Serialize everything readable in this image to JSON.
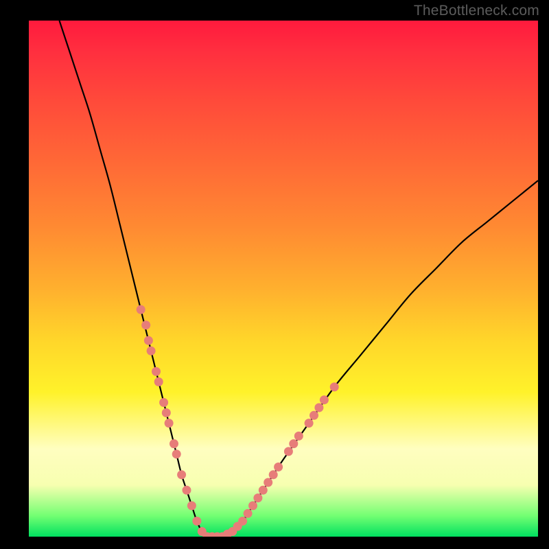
{
  "watermark": "TheBottleneck.com",
  "colors": {
    "frame": "#000000",
    "curve": "#000000",
    "markers": "#e77d79",
    "gradient_stops": [
      "#ff1a3d",
      "#ff4b3a",
      "#ff8a32",
      "#ffd62a",
      "#fffec0",
      "#72ff72",
      "#00e060"
    ]
  },
  "chart_data": {
    "type": "line",
    "title": "",
    "xlabel": "",
    "ylabel": "",
    "xlim": [
      0,
      100
    ],
    "ylim": [
      0,
      100
    ],
    "grid": false,
    "legend": null,
    "note": "Axes are unlabeled. x treated as 0–100 left→right, y as 0–100 bottom→top. Curve is a V-shape: left branch falls steeply from near top-left into a trough around x≈33–40 at y≈0, right branch rises more gently toward the upper-right.",
    "series": [
      {
        "name": "curve",
        "x": [
          6,
          8,
          10,
          12,
          14,
          16,
          18,
          20,
          22,
          24,
          26,
          27,
          28,
          29,
          30,
          31,
          32,
          33,
          34,
          35,
          36,
          37,
          38,
          40,
          42,
          44,
          46,
          48,
          50,
          55,
          60,
          65,
          70,
          75,
          80,
          85,
          90,
          95,
          100
        ],
        "y": [
          100,
          94,
          88,
          82,
          75,
          68,
          60,
          52,
          44,
          36,
          28,
          24,
          20,
          16,
          12,
          9,
          6,
          3,
          1,
          0,
          0,
          0,
          0,
          1,
          3,
          6,
          9,
          12,
          15,
          22,
          29,
          35,
          41,
          47,
          52,
          57,
          61,
          65,
          69
        ]
      }
    ],
    "markers": {
      "name": "highlighted-points",
      "color": "#e77d79",
      "note": "Pink dot/segment overlays along the lower portion of both branches and across the trough.",
      "points": [
        {
          "x": 22,
          "y": 44
        },
        {
          "x": 23,
          "y": 41
        },
        {
          "x": 23.5,
          "y": 38
        },
        {
          "x": 24,
          "y": 36
        },
        {
          "x": 25,
          "y": 32
        },
        {
          "x": 25.5,
          "y": 30
        },
        {
          "x": 26.5,
          "y": 26
        },
        {
          "x": 27,
          "y": 24
        },
        {
          "x": 27.5,
          "y": 22
        },
        {
          "x": 28.5,
          "y": 18
        },
        {
          "x": 29,
          "y": 16
        },
        {
          "x": 30,
          "y": 12
        },
        {
          "x": 31,
          "y": 9
        },
        {
          "x": 32,
          "y": 6
        },
        {
          "x": 33,
          "y": 3
        },
        {
          "x": 34,
          "y": 1
        },
        {
          "x": 35,
          "y": 0
        },
        {
          "x": 36,
          "y": 0
        },
        {
          "x": 37,
          "y": 0
        },
        {
          "x": 38,
          "y": 0
        },
        {
          "x": 39,
          "y": 0.5
        },
        {
          "x": 40,
          "y": 1
        },
        {
          "x": 41,
          "y": 2
        },
        {
          "x": 42,
          "y": 3
        },
        {
          "x": 43,
          "y": 4.5
        },
        {
          "x": 44,
          "y": 6
        },
        {
          "x": 45,
          "y": 7.5
        },
        {
          "x": 46,
          "y": 9
        },
        {
          "x": 47,
          "y": 10.5
        },
        {
          "x": 48,
          "y": 12
        },
        {
          "x": 49,
          "y": 13.5
        },
        {
          "x": 51,
          "y": 16.5
        },
        {
          "x": 52,
          "y": 18
        },
        {
          "x": 53,
          "y": 19.5
        },
        {
          "x": 55,
          "y": 22
        },
        {
          "x": 56,
          "y": 23.5
        },
        {
          "x": 57,
          "y": 25
        },
        {
          "x": 58,
          "y": 26.5
        },
        {
          "x": 60,
          "y": 29
        }
      ]
    }
  }
}
